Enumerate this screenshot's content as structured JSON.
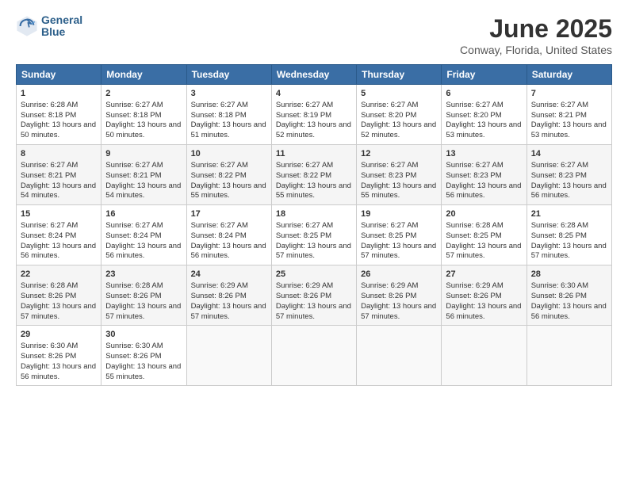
{
  "logo": {
    "general": "General",
    "blue": "Blue"
  },
  "title": "June 2025",
  "subtitle": "Conway, Florida, United States",
  "days_header": [
    "Sunday",
    "Monday",
    "Tuesday",
    "Wednesday",
    "Thursday",
    "Friday",
    "Saturday"
  ],
  "weeks": [
    [
      {
        "num": "1",
        "sunrise": "6:28 AM",
        "sunset": "8:18 PM",
        "daylight": "13 hours and 50 minutes."
      },
      {
        "num": "2",
        "sunrise": "6:27 AM",
        "sunset": "8:18 PM",
        "daylight": "13 hours and 50 minutes."
      },
      {
        "num": "3",
        "sunrise": "6:27 AM",
        "sunset": "8:18 PM",
        "daylight": "13 hours and 51 minutes."
      },
      {
        "num": "4",
        "sunrise": "6:27 AM",
        "sunset": "8:19 PM",
        "daylight": "13 hours and 52 minutes."
      },
      {
        "num": "5",
        "sunrise": "6:27 AM",
        "sunset": "8:20 PM",
        "daylight": "13 hours and 52 minutes."
      },
      {
        "num": "6",
        "sunrise": "6:27 AM",
        "sunset": "8:20 PM",
        "daylight": "13 hours and 53 minutes."
      },
      {
        "num": "7",
        "sunrise": "6:27 AM",
        "sunset": "8:21 PM",
        "daylight": "13 hours and 53 minutes."
      }
    ],
    [
      {
        "num": "8",
        "sunrise": "6:27 AM",
        "sunset": "8:21 PM",
        "daylight": "13 hours and 54 minutes."
      },
      {
        "num": "9",
        "sunrise": "6:27 AM",
        "sunset": "8:21 PM",
        "daylight": "13 hours and 54 minutes."
      },
      {
        "num": "10",
        "sunrise": "6:27 AM",
        "sunset": "8:22 PM",
        "daylight": "13 hours and 55 minutes."
      },
      {
        "num": "11",
        "sunrise": "6:27 AM",
        "sunset": "8:22 PM",
        "daylight": "13 hours and 55 minutes."
      },
      {
        "num": "12",
        "sunrise": "6:27 AM",
        "sunset": "8:23 PM",
        "daylight": "13 hours and 55 minutes."
      },
      {
        "num": "13",
        "sunrise": "6:27 AM",
        "sunset": "8:23 PM",
        "daylight": "13 hours and 56 minutes."
      },
      {
        "num": "14",
        "sunrise": "6:27 AM",
        "sunset": "8:23 PM",
        "daylight": "13 hours and 56 minutes."
      }
    ],
    [
      {
        "num": "15",
        "sunrise": "6:27 AM",
        "sunset": "8:24 PM",
        "daylight": "13 hours and 56 minutes."
      },
      {
        "num": "16",
        "sunrise": "6:27 AM",
        "sunset": "8:24 PM",
        "daylight": "13 hours and 56 minutes."
      },
      {
        "num": "17",
        "sunrise": "6:27 AM",
        "sunset": "8:24 PM",
        "daylight": "13 hours and 56 minutes."
      },
      {
        "num": "18",
        "sunrise": "6:27 AM",
        "sunset": "8:25 PM",
        "daylight": "13 hours and 57 minutes."
      },
      {
        "num": "19",
        "sunrise": "6:27 AM",
        "sunset": "8:25 PM",
        "daylight": "13 hours and 57 minutes."
      },
      {
        "num": "20",
        "sunrise": "6:28 AM",
        "sunset": "8:25 PM",
        "daylight": "13 hours and 57 minutes."
      },
      {
        "num": "21",
        "sunrise": "6:28 AM",
        "sunset": "8:25 PM",
        "daylight": "13 hours and 57 minutes."
      }
    ],
    [
      {
        "num": "22",
        "sunrise": "6:28 AM",
        "sunset": "8:26 PM",
        "daylight": "13 hours and 57 minutes."
      },
      {
        "num": "23",
        "sunrise": "6:28 AM",
        "sunset": "8:26 PM",
        "daylight": "13 hours and 57 minutes."
      },
      {
        "num": "24",
        "sunrise": "6:29 AM",
        "sunset": "8:26 PM",
        "daylight": "13 hours and 57 minutes."
      },
      {
        "num": "25",
        "sunrise": "6:29 AM",
        "sunset": "8:26 PM",
        "daylight": "13 hours and 57 minutes."
      },
      {
        "num": "26",
        "sunrise": "6:29 AM",
        "sunset": "8:26 PM",
        "daylight": "13 hours and 57 minutes."
      },
      {
        "num": "27",
        "sunrise": "6:29 AM",
        "sunset": "8:26 PM",
        "daylight": "13 hours and 56 minutes."
      },
      {
        "num": "28",
        "sunrise": "6:30 AM",
        "sunset": "8:26 PM",
        "daylight": "13 hours and 56 minutes."
      }
    ],
    [
      {
        "num": "29",
        "sunrise": "6:30 AM",
        "sunset": "8:26 PM",
        "daylight": "13 hours and 56 minutes."
      },
      {
        "num": "30",
        "sunrise": "6:30 AM",
        "sunset": "8:26 PM",
        "daylight": "13 hours and 55 minutes."
      },
      null,
      null,
      null,
      null,
      null
    ]
  ]
}
